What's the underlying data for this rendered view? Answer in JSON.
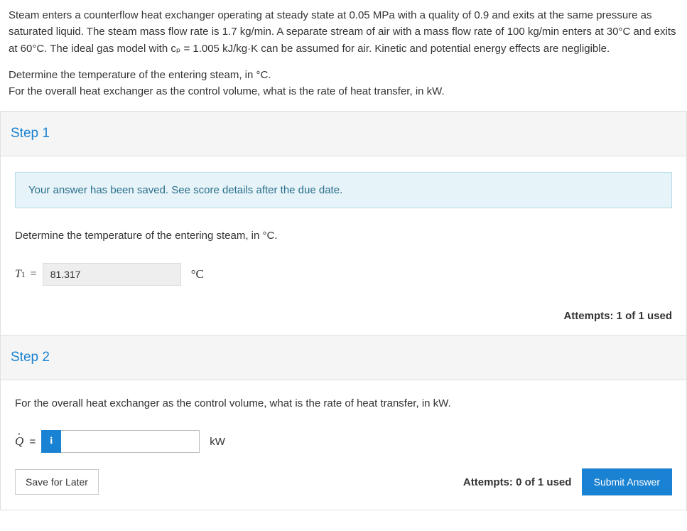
{
  "problem": {
    "para1": "Steam enters a counterflow heat exchanger operating at steady state at 0.05 MPa with a quality of 0.9 and exits at the same pressure as saturated liquid. The steam mass flow rate is 1.7 kg/min. A separate stream of air with a mass flow rate of 100 kg/min enters at 30°C and exits at 60°C. The ideal gas model with cₚ = 1.005 kJ/kg·K can be assumed for air. Kinetic and potential energy effects are negligible.",
    "para2a": "Determine the temperature of the entering steam, in °C.",
    "para2b": "For the overall heat exchanger as the control volume, what is the rate of heat transfer, in kW."
  },
  "step1": {
    "title": "Step 1",
    "saved_msg": "Your answer has been saved. See score details after the due date.",
    "question": "Determine the temperature of the entering steam, in °C.",
    "var_label": "T",
    "var_sub": "1",
    "equals": "=",
    "value": "81.317",
    "unit": "°C",
    "attempts": "Attempts: 1 of 1 used"
  },
  "step2": {
    "title": "Step 2",
    "question": "For the overall heat exchanger as the control volume, what is the rate of heat transfer, in kW.",
    "var_label": "Q",
    "equals": "=",
    "info_icon": "i",
    "value": "",
    "unit": "kW",
    "save_label": "Save for Later",
    "attempts": "Attempts: 0 of 1 used",
    "submit_label": "Submit Answer"
  }
}
